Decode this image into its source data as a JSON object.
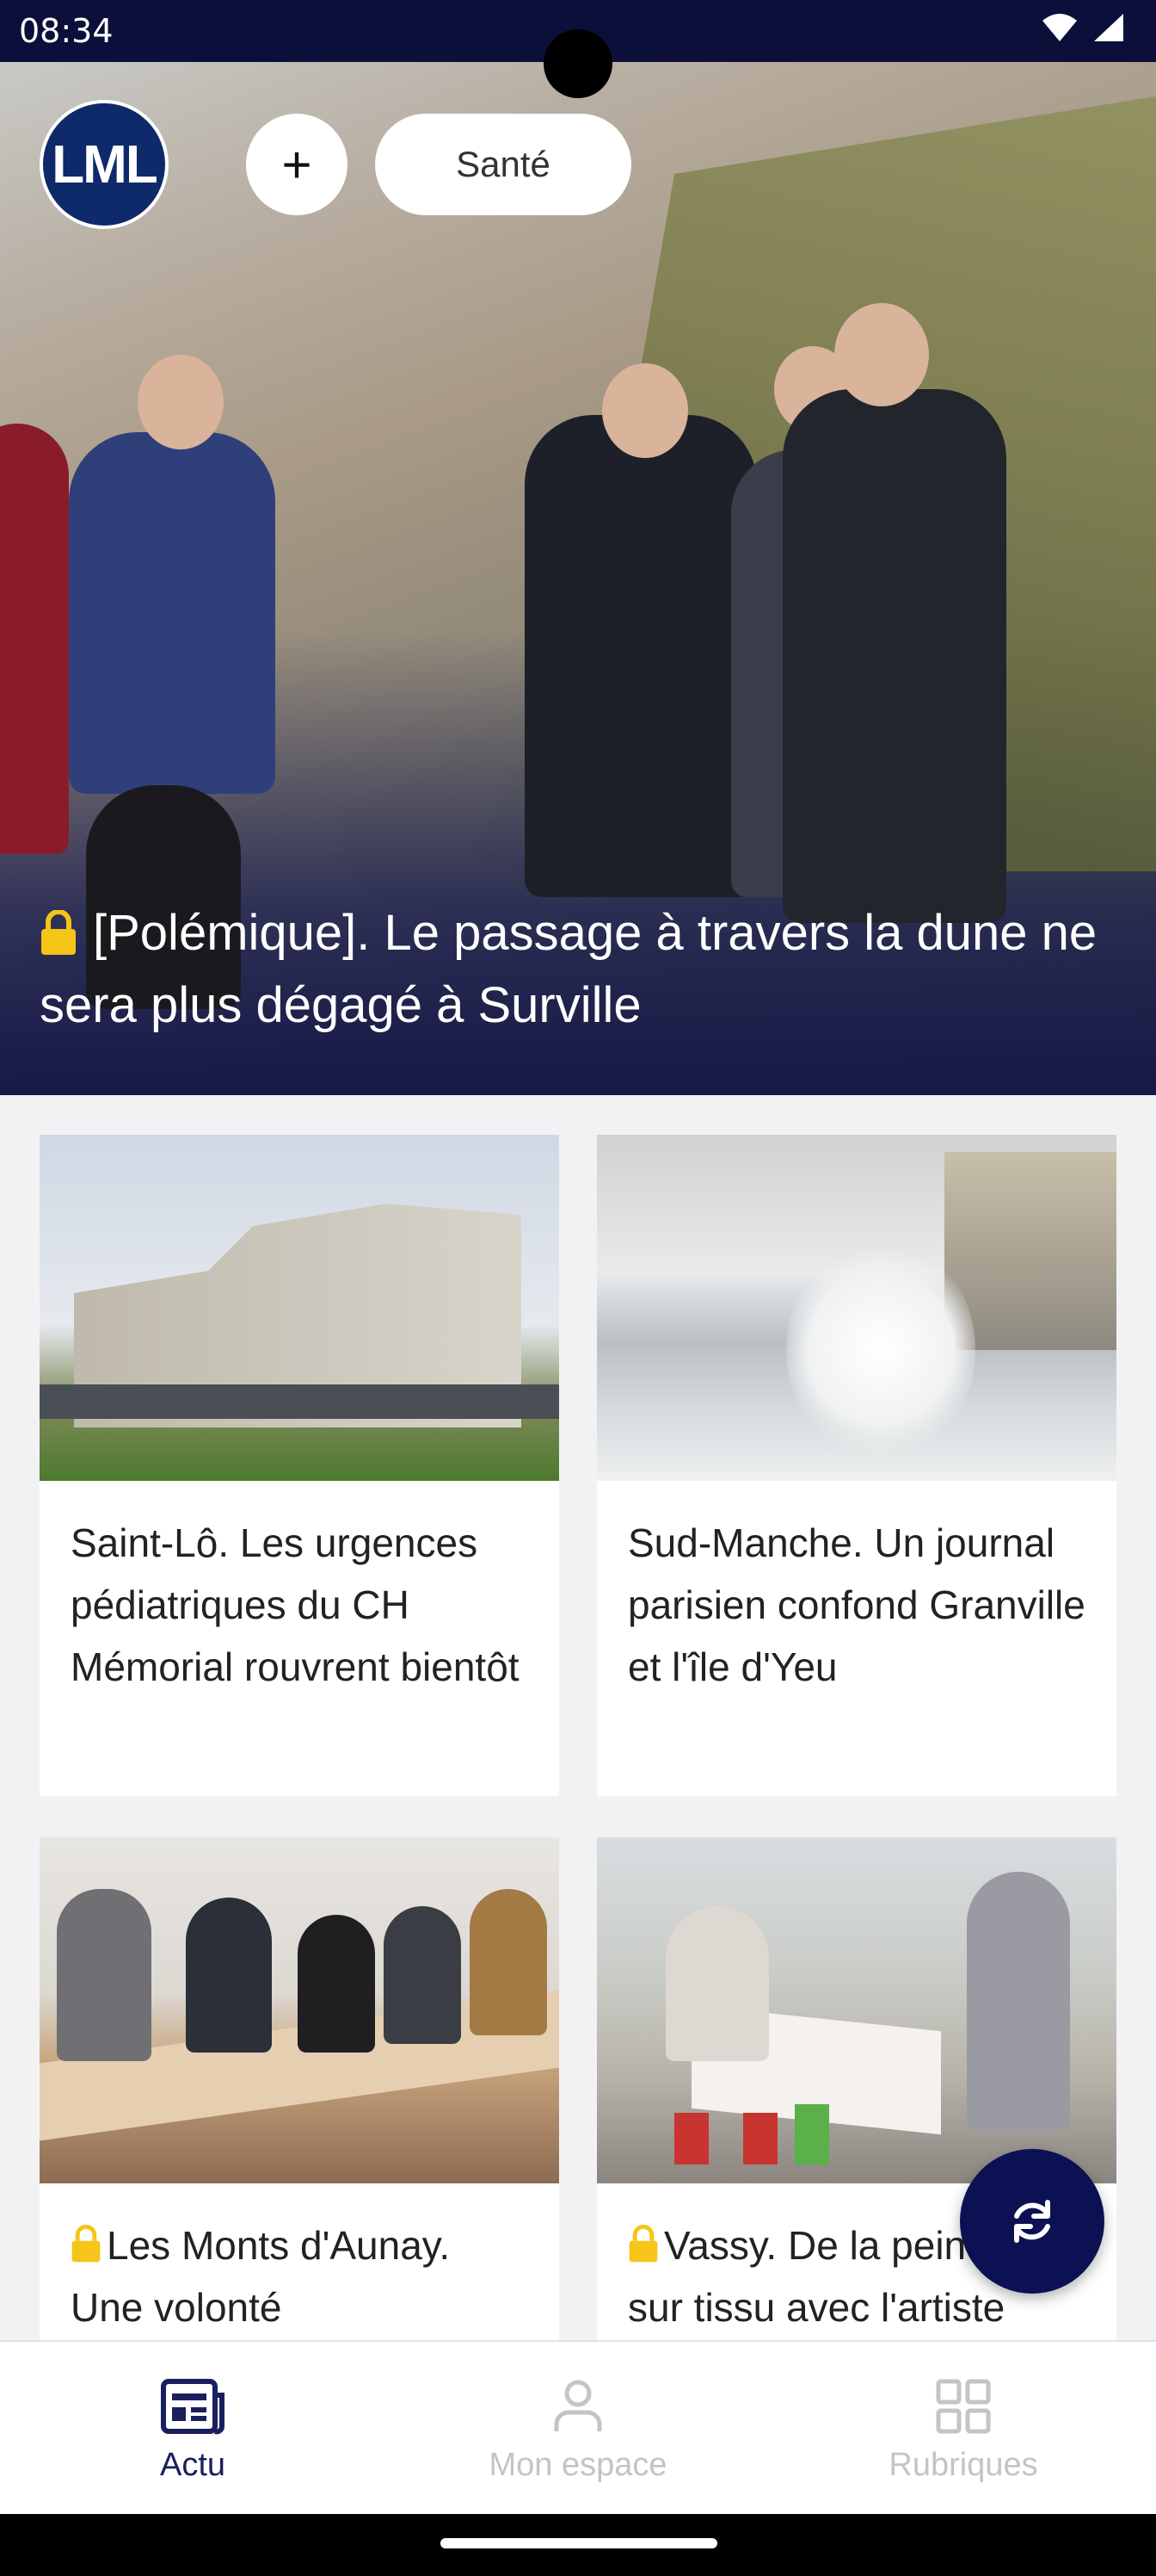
{
  "status_bar": {
    "time": "08:34"
  },
  "header": {
    "logo_text": "LML",
    "add_button_label": "+",
    "chip_label": "Santé"
  },
  "hero": {
    "title": "[Polémique]. Le passage à travers la dune ne sera plus dégagé à Surville",
    "locked": true
  },
  "articles": [
    {
      "title": "Saint-Lô. Les urgences pédiatriques du CH Mémorial rouvrent bientôt",
      "locked": false
    },
    {
      "title": "Sud-Manche. Un journal parisien confond Granville et l'île d'Yeu",
      "locked": false
    },
    {
      "title": "Les Monts d'Aunay. Une volonté",
      "locked": true
    },
    {
      "title": "Vassy. De la peinture sur tissu avec l'artiste",
      "locked": true
    }
  ],
  "bottom_nav": [
    {
      "label": "Actu",
      "icon": "newspaper-icon",
      "active": true
    },
    {
      "label": "Mon espace",
      "icon": "person-icon",
      "active": false
    },
    {
      "label": "Rubriques",
      "icon": "grid-icon",
      "active": false
    }
  ],
  "colors": {
    "brand_navy": "#0b1152",
    "lock_yellow": "#f5c518",
    "inactive_gray": "#c4c4c4"
  }
}
